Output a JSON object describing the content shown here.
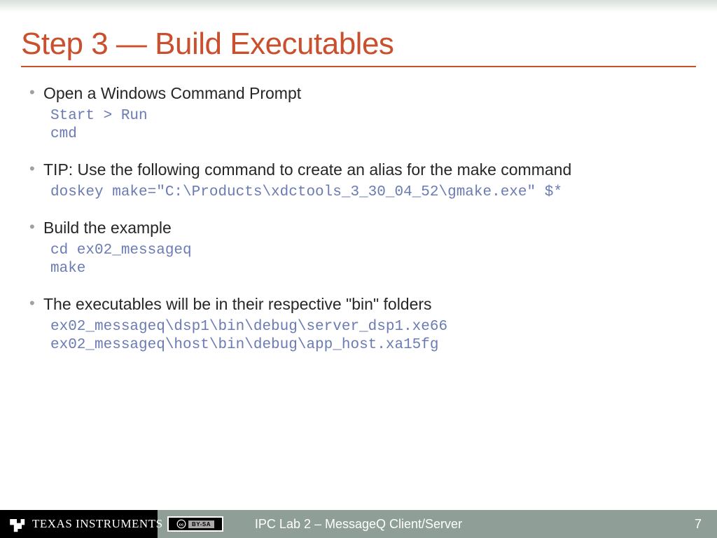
{
  "slide": {
    "title": "Step 3 — Build Executables",
    "bullets": [
      {
        "text": "Open a Windows Command Prompt",
        "code": "Start > Run\ncmd"
      },
      {
        "text": "TIP: Use the following command to create an alias for the make command",
        "code": "doskey make=\"C:\\Products\\xdctools_3_30_04_52\\gmake.exe\" $*"
      },
      {
        "text": "Build the example",
        "code": "cd ex02_messageq\nmake"
      },
      {
        "text": "The executables will be in their respective \"bin\" folders",
        "code": "ex02_messageq\\dsp1\\bin\\debug\\server_dsp1.xe66\nex02_messageq\\host\\bin\\debug\\app_host.xa15fg"
      }
    ]
  },
  "footer": {
    "logo_text": "TEXAS INSTRUMENTS",
    "cc_label": "BY-SA",
    "title": "IPC Lab 2 – MessageQ Client/Server",
    "page": "7"
  }
}
